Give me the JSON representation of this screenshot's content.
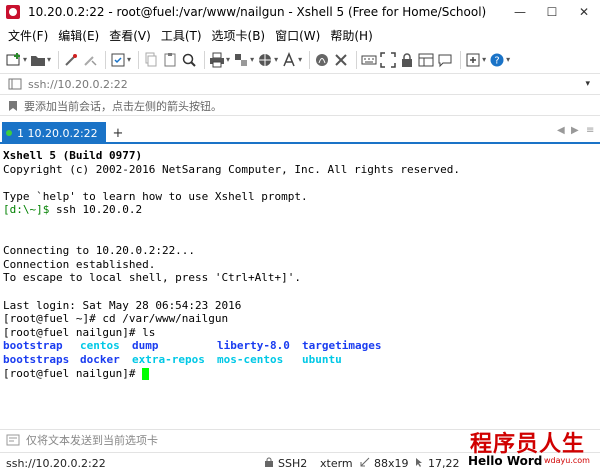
{
  "window": {
    "title": "10.20.0.2:22 - root@fuel:/var/www/nailgun - Xshell 5 (Free for Home/School)",
    "min_label": "—",
    "max_label": "☐",
    "close_label": "✕"
  },
  "menu": {
    "items": [
      "文件(F)",
      "编辑(E)",
      "查看(V)",
      "工具(T)",
      "选项卡(B)",
      "窗口(W)",
      "帮助(H)"
    ]
  },
  "address": {
    "value": "ssh://10.20.0.2:22"
  },
  "hint": {
    "text": "要添加当前会话，点击左侧的箭头按钮。"
  },
  "tabs": {
    "active_label": "1 10.20.0.2:22",
    "add_label": "+",
    "prev_label": "◀",
    "next_label": "▶",
    "menu_label": "≡"
  },
  "terminal": {
    "lines": [
      "Xshell 5 (Build 0977)",
      "Copyright (c) 2002-2016 NetSarang Computer, Inc. All rights reserved.",
      "",
      "Type `help' to learn how to use Xshell prompt.",
      "ssh 10.20.0.2",
      "",
      "",
      "Connecting to 10.20.0.2:22...",
      "Connection established.",
      "To escape to local shell, press 'Ctrl+Alt+]'.",
      "",
      "Last login: Sat May 28 06:54:23 2016",
      "[root@fuel ~]# cd /var/www/nailgun",
      "[root@fuel nailgun]# ls"
    ],
    "local_prompt": "[d:\\~]$ ",
    "ls_row1": [
      "bootstrap",
      "centos",
      "dump",
      "liberty-8.0",
      "targetimages"
    ],
    "ls_row2": [
      "bootstraps",
      "docker",
      "extra-repos",
      "mos-centos",
      "ubuntu"
    ],
    "final_prompt": "[root@fuel nailgun]# ",
    "colors": {
      "dir": "#1a3cf0",
      "link": "#00c8e6",
      "prompt": "#008000",
      "cursor": "#00ff00"
    }
  },
  "sendbar": {
    "text": "仅将文本发送到当前选项卡"
  },
  "status": {
    "connection": "ssh://10.20.0.2:22",
    "protocol": "SSH2",
    "terminal": "xterm",
    "size": "88x19",
    "cursor_pos": "17,22"
  },
  "watermark": {
    "title": "程序员人生",
    "subtitle": "Hello Word",
    "url": "wdayu.com"
  },
  "accent": "#1a73c7"
}
